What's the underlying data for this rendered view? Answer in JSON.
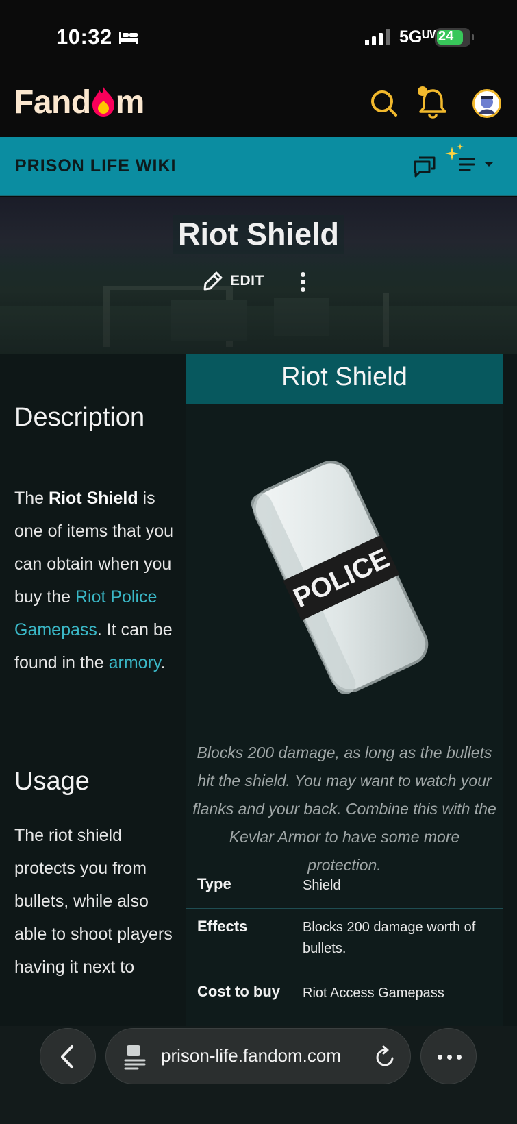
{
  "status_bar": {
    "time": "10:32",
    "network": "5Gᵁᵂ",
    "battery": "24"
  },
  "header": {
    "logo_text_left": "Fand",
    "logo_text_right": "m"
  },
  "wiki_bar": {
    "name": "PRISON LIFE WIKI"
  },
  "hero": {
    "title": "Riot Shield",
    "edit_label": "EDIT"
  },
  "article": {
    "desc_heading": "Description",
    "desc_p1": "The ",
    "desc_bold": "Riot Shield",
    "desc_p2": " is one of items that you can obtain when you buy the ",
    "desc_link1": "Riot Police Gamepass",
    "desc_p3": ". It can be found in the ",
    "desc_link2": "armory",
    "desc_p4": ".",
    "usage_heading": "Usage",
    "usage_text": "The riot shield protects you from bullets, while also able to shoot players having it next to"
  },
  "infobox": {
    "title": "Riot Shield",
    "image_text": "POLICE",
    "caption": "Blocks 200 damage, as long as the bullets hit the shield. You may want to watch your flanks and your back. Combine this with the Kevlar Armor to have some more protection.",
    "rows": [
      {
        "label": "Type",
        "value": "Shield"
      },
      {
        "label": "Effects",
        "value": "Blocks 200 damage worth of bullets."
      },
      {
        "label": "Cost to buy",
        "value": "Riot Access Gamepass"
      }
    ]
  },
  "browser": {
    "url": "prison-life.fandom.com"
  },
  "colors": {
    "wiki_bar": "#0b8da1",
    "infobox_title": "#07585e",
    "link": "#3ab7c6",
    "accent_yellow": "#f2b92d",
    "fandom_red": "#fa005a"
  },
  "icons": [
    "bed-icon",
    "signal-icon",
    "battery-icon",
    "search-icon",
    "bell-icon",
    "avatar",
    "discussion-icon",
    "sparkle-icon",
    "menu-icon",
    "pencil-icon",
    "more-vertical-icon",
    "back-icon",
    "page-icon",
    "reload-icon",
    "more-horizontal-icon"
  ]
}
